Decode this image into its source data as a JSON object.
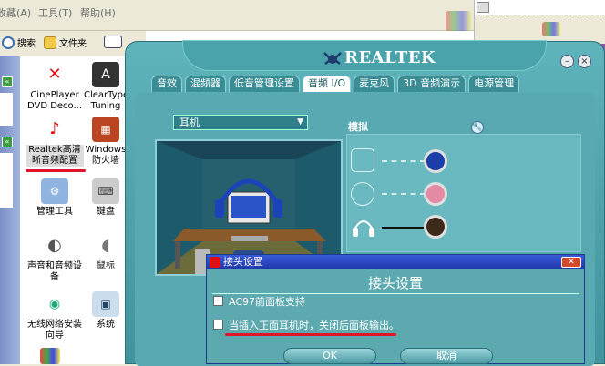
{
  "menubar": {
    "items": [
      "收藏(A)",
      "工具(T)",
      "帮助(H)"
    ]
  },
  "toolbar": {
    "search_label": "搜索",
    "folders_label": "文件夹"
  },
  "control_panel": {
    "items": [
      {
        "label": "CinePlayer DVD Deco...",
        "icon": "cineplayer-icon"
      },
      {
        "label": "ClearType Tuning",
        "icon": "cleartype-icon"
      },
      {
        "label": "Realtek高清晰音频配置",
        "icon": "realtek-icon"
      },
      {
        "label": "Windows 防火墙",
        "icon": "firewall-icon"
      },
      {
        "label": "管理工具",
        "icon": "admin-tools-icon"
      },
      {
        "label": "键盘",
        "icon": "keyboard-icon"
      },
      {
        "label": "声音和音频设备",
        "icon": "speaker-icon"
      },
      {
        "label": "鼠标",
        "icon": "mouse-icon"
      },
      {
        "label": "无线网络安装向导",
        "icon": "wireless-icon"
      },
      {
        "label": "系统",
        "icon": "system-icon"
      }
    ]
  },
  "realtek": {
    "brand": "REALTEK",
    "tabs": [
      "音效",
      "混频器",
      "音频I/O",
      "麦克风",
      "3D 音频演示",
      "电源管理"
    ],
    "active_tab": "音频I/O",
    "tab_labels_visible": [
      "音效",
      "混频器",
      "低音管理设置",
      "音频 I/O",
      "麦克风",
      "3D 音频演示",
      "电源管理"
    ],
    "device_select": "耳机",
    "analog_label": "模拟",
    "jack_colors": [
      "#1a3fa8",
      "#e58aa4",
      "#3b2a1a"
    ]
  },
  "dialog": {
    "title": "接头设置",
    "heading": "接头设置",
    "options": [
      {
        "label": "AC97前面板支持",
        "checked": false
      },
      {
        "label": "当插入正面耳机时，关闭后面板输出。",
        "checked": false
      }
    ],
    "ok_label": "OK",
    "cancel_label": "取消"
  }
}
